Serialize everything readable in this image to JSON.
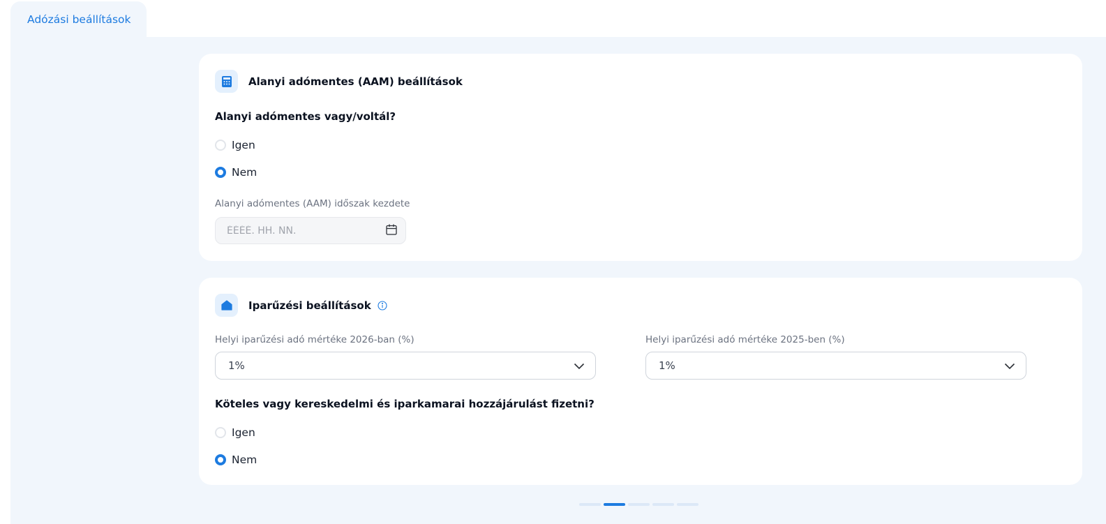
{
  "tab": {
    "label": "Adózási beállítások"
  },
  "aam": {
    "title": "Alanyi adómentes (AAM) beállítások",
    "question": "Alanyi adómentes vagy/voltál?",
    "options": [
      {
        "label": "Igen",
        "checked": false
      },
      {
        "label": "Nem",
        "checked": true
      }
    ],
    "date_label": "Alanyi adómentes (AAM) időszak kezdete",
    "date_placeholder": "ÉÉÉÉ. HH. NN."
  },
  "iparuzes": {
    "title": "Iparűzési beállítások",
    "rate_2026_label": "Helyi iparűzési adó mértéke 2026-ban (%)",
    "rate_2026_value": "1%",
    "rate_2025_label": "Helyi iparűzési adó mértéke 2025-ben (%)",
    "rate_2025_value": "1%",
    "question": "Köteles vagy kereskedelmi és iparkamarai hozzájárulást fizetni?",
    "options": [
      {
        "label": "Igen",
        "checked": false
      },
      {
        "label": "Nem",
        "checked": true
      }
    ]
  },
  "pager": {
    "total": 5,
    "active": 2
  },
  "colors": {
    "accent": "#1d7be0",
    "panel_bg": "#f1f6fc",
    "icon_bg": "#e4f0fd"
  }
}
